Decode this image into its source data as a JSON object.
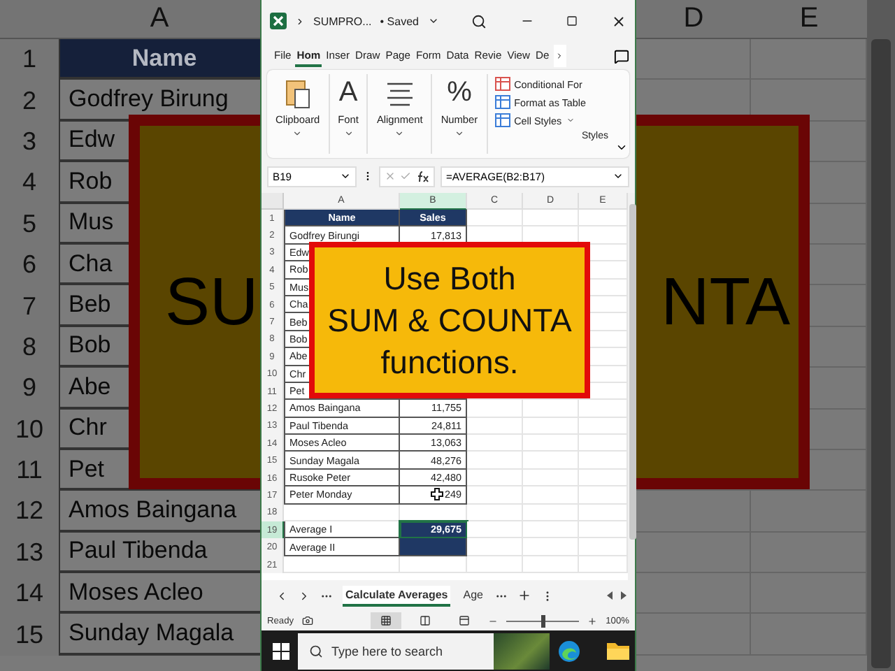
{
  "backdrop_left": {
    "column": "A",
    "rows": [
      {
        "number": "1",
        "name": "Name",
        "kind": "header"
      },
      {
        "number": "2",
        "name": "Godfrey Birung",
        "kind": "data"
      },
      {
        "number": "3",
        "name": "Edw",
        "kind": "data"
      },
      {
        "number": "4",
        "name": "Rob",
        "kind": "data"
      },
      {
        "number": "5",
        "name": "Mus",
        "kind": "data"
      },
      {
        "number": "6",
        "name": "Cha",
        "kind": "data"
      },
      {
        "number": "7",
        "name": "Beb",
        "kind": "data"
      },
      {
        "number": "8",
        "name": "Bob",
        "kind": "data"
      },
      {
        "number": "9",
        "name": "Abe",
        "kind": "data"
      },
      {
        "number": "10",
        "name": "Chr",
        "kind": "data"
      },
      {
        "number": "11",
        "name": "Pet",
        "kind": "data"
      },
      {
        "number": "12",
        "name": "Amos Baingana",
        "kind": "data"
      },
      {
        "number": "13",
        "name": "Paul Tibenda",
        "kind": "data"
      },
      {
        "number": "14",
        "name": "Moses Acleo",
        "kind": "data"
      },
      {
        "number": "15",
        "name": "Sunday Magala",
        "kind": "data"
      }
    ],
    "banner_text": "SU"
  },
  "backdrop_right": {
    "columns": [
      "D",
      "E"
    ],
    "banner_text": "NTA"
  },
  "window": {
    "title": "SUMPRO...",
    "status": "• Saved"
  },
  "tabs": [
    {
      "label": "File",
      "selected": false
    },
    {
      "label": "Hom",
      "selected": true
    },
    {
      "label": "Inser",
      "selected": false
    },
    {
      "label": "Draw",
      "selected": false
    },
    {
      "label": "Page",
      "selected": false
    },
    {
      "label": "Form",
      "selected": false
    },
    {
      "label": "Data",
      "selected": false
    },
    {
      "label": "Revie",
      "selected": false
    },
    {
      "label": "View",
      "selected": false
    },
    {
      "label": "De",
      "selected": false
    }
  ],
  "ribbon": {
    "groups": [
      {
        "label": "Clipboard",
        "kind": "clipboard"
      },
      {
        "label": "Font",
        "kind": "glyph",
        "glyph": "A"
      },
      {
        "label": "Alignment",
        "kind": "lines"
      },
      {
        "label": "Number",
        "kind": "glyph",
        "glyph": "%"
      }
    ],
    "styles": [
      {
        "label": "Conditional For",
        "kind": "conditional"
      },
      {
        "label": "Format as Table",
        "kind": "table"
      },
      {
        "label": "Cell Styles",
        "kind": "cellstyles"
      }
    ],
    "styles_label": "Styles"
  },
  "formula_bar": {
    "name_box": "B19",
    "formula": "=AVERAGE(B2:B17)"
  },
  "grid": {
    "columns": [
      "A",
      "B",
      "C",
      "D",
      "E"
    ],
    "rows": [
      {
        "number": "1",
        "name": "Name",
        "value": "Sales",
        "kind": "header",
        "selected": false
      },
      {
        "number": "2",
        "name": "Godfrey Birungi",
        "value": "17,813",
        "kind": "data",
        "selected": false
      },
      {
        "number": "3",
        "name": "Edw",
        "kind": "data",
        "selected": false
      },
      {
        "number": "4",
        "name": "Rob",
        "kind": "data",
        "selected": false
      },
      {
        "number": "5",
        "name": "Mus",
        "kind": "data",
        "selected": false
      },
      {
        "number": "6",
        "name": "Cha",
        "kind": "data",
        "selected": false
      },
      {
        "number": "7",
        "name": "Beb",
        "kind": "data",
        "selected": false
      },
      {
        "number": "8",
        "name": "Bob",
        "kind": "data",
        "selected": false
      },
      {
        "number": "9",
        "name": "Abe",
        "kind": "data",
        "selected": false
      },
      {
        "number": "10",
        "name": "Chr",
        "kind": "data",
        "selected": false
      },
      {
        "number": "11",
        "name": "Pet",
        "kind": "data",
        "selected": false
      },
      {
        "number": "12",
        "name": "Amos Baingana",
        "value": "11,755",
        "kind": "data",
        "selected": false
      },
      {
        "number": "13",
        "name": "Paul Tibenda",
        "value": "24,811",
        "kind": "data",
        "selected": false
      },
      {
        "number": "14",
        "name": "Moses Acleo",
        "value": "13,063",
        "kind": "data",
        "selected": false
      },
      {
        "number": "15",
        "name": "Sunday Magala",
        "value": "48,276",
        "kind": "data",
        "selected": false
      },
      {
        "number": "16",
        "name": "Rusoke Peter",
        "value": "42,480",
        "kind": "data",
        "selected": false
      },
      {
        "number": "17",
        "name": "Peter Monday",
        "value": "249",
        "kind": "data",
        "selected": false,
        "cursor": true
      },
      {
        "number": "18",
        "kind": "empty",
        "selected": false
      },
      {
        "number": "19",
        "name": "Average I",
        "value": "29,675",
        "kind": "average",
        "selected": true
      },
      {
        "number": "20",
        "name": "Average II",
        "kind": "average",
        "selected": false
      },
      {
        "number": "21",
        "kind": "empty",
        "selected": false
      }
    ]
  },
  "banner": {
    "lines": [
      "Use Both",
      "SUM & COUNTA",
      "functions."
    ]
  },
  "sheet_tabs": [
    {
      "label": "Calculate Averages",
      "selected": true
    },
    {
      "label": "Age",
      "selected": false
    }
  ],
  "status_bar": {
    "status": "Ready",
    "views": [
      {
        "kind": "normal",
        "selected": true
      },
      {
        "kind": "layout",
        "selected": false
      },
      {
        "kind": "break",
        "selected": false
      }
    ],
    "zoom_slider": {
      "level": 0.5
    },
    "zoom": "100%"
  },
  "taskbar": {
    "search_placeholder": "Type here to search"
  }
}
